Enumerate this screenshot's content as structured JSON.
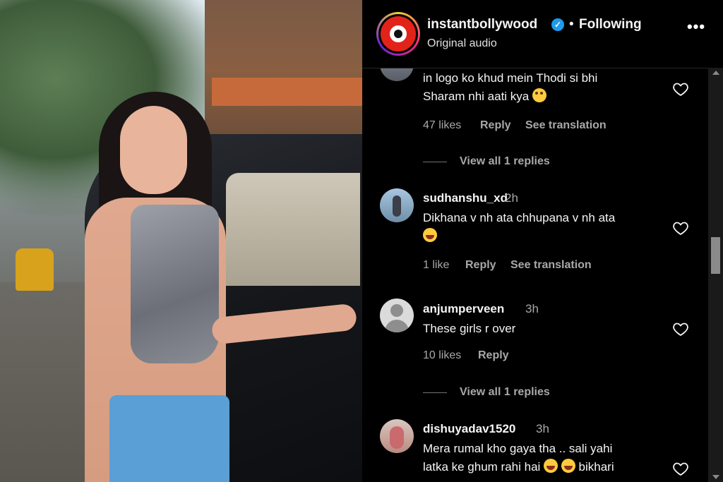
{
  "header": {
    "username": "instantbollywood",
    "separator": "•",
    "follow_status": "Following",
    "subtitle": "Original audio",
    "more_icon": "•••"
  },
  "comments": [
    {
      "user": "",
      "time": "",
      "text_line1": "in logo ko khud mein Thodi si bhi",
      "text_line2": "Sharam nhi aati kya",
      "likes": "47 likes",
      "reply": "Reply",
      "translation": "See translation",
      "view_replies": "View all 1 replies"
    },
    {
      "user": "sudhanshu_xd",
      "time": "2h",
      "text_line1": "Dikhana v nh ata chhupana v nh ata",
      "likes": "1 like",
      "reply": "Reply",
      "translation": "See translation"
    },
    {
      "user": "anjumperveen",
      "time": "3h",
      "text_line1": "These girls r over",
      "likes": "10 likes",
      "reply": "Reply",
      "view_replies": "View all 1 replies"
    },
    {
      "user": "dishuyadav1520",
      "time": "3h",
      "text_line1": "Mera rumal kho gaya tha .. sali yahi",
      "text_line2": "latka ke ghum rahi hai",
      "text_tail": "bikhari"
    }
  ],
  "colors": {
    "background": "#000000",
    "text_primary": "#f5f5f5",
    "text_secondary": "#a8a8a8",
    "verified": "#1d9bf0"
  }
}
